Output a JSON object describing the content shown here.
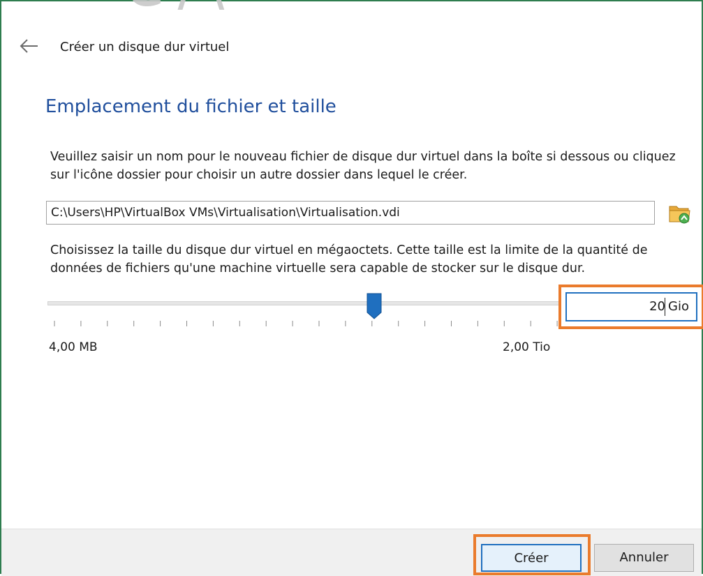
{
  "watermark": {
    "text": "G/\\"
  },
  "header": {
    "back_icon": "arrow-left-icon",
    "title": "Créer un disque dur virtuel"
  },
  "section": {
    "title": "Emplacement du fichier et taille"
  },
  "file": {
    "instructions": "Veuillez saisir un nom pour le nouveau fichier de disque dur virtuel dans la boîte si dessous ou cliquez sur l'icône dossier pour choisir un autre dossier dans lequel le créer.",
    "path_value": "C:\\Users\\HP\\VirtualBox VMs\\Virtualisation\\Virtualisation.vdi",
    "folder_icon": "folder-open-icon"
  },
  "size": {
    "instructions": "Choisissez la taille du disque dur virtuel en mégaoctets. Cette taille est la limite de la quantité de données de fichiers qu'une machine virtuelle sera capable de stocker sur le disque dur.",
    "slider_min_label": "4,00 MB",
    "slider_max_label": "2,00 Tio",
    "slider_position_fraction": 0.64,
    "value": "20",
    "unit": "Gio"
  },
  "buttons": {
    "create_label": "Créer",
    "cancel_label": "Annuler"
  },
  "colors": {
    "title_blue": "#1f4e9c",
    "highlight_orange": "#ea7b2c",
    "focus_blue": "#1f6fbf",
    "window_border_green": "#2e7d4f"
  }
}
